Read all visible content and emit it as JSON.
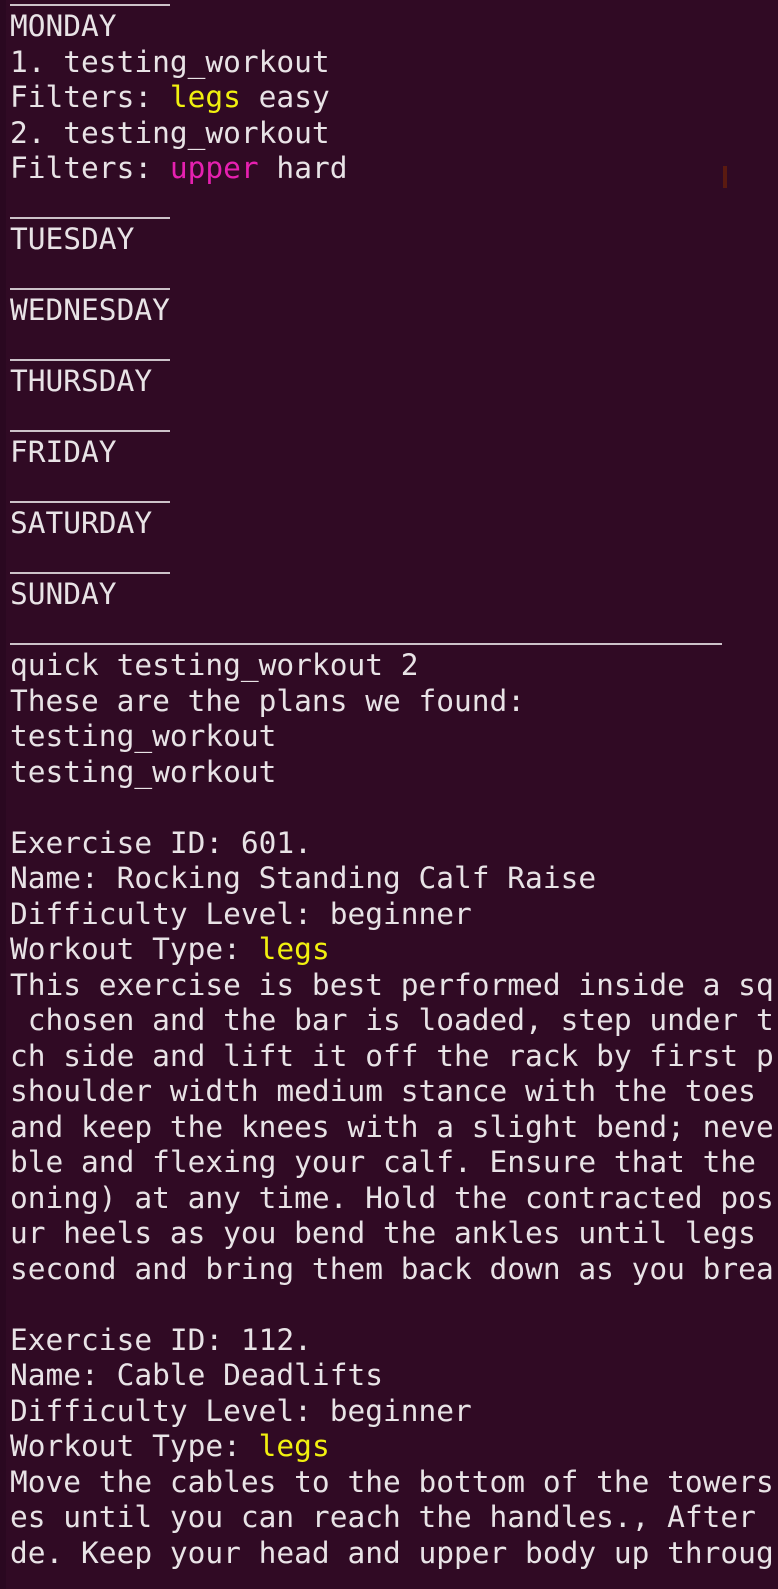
{
  "colors": {
    "background": "#300a24",
    "text": "#e8e3e6",
    "legs_tag": "#f1f10f",
    "upper_tag": "#e620b0"
  },
  "schedule": {
    "monday": "MONDAY",
    "workouts": [
      {
        "line": "1. testing_workout",
        "filters_label": "Filters: ",
        "tag": "legs",
        "level": " easy"
      },
      {
        "line": "2. testing_workout",
        "filters_label": "Filters: ",
        "tag": "upper",
        "level": " hard"
      }
    ],
    "days": [
      "TUESDAY",
      "WEDNESDAY",
      "THURSDAY",
      "FRIDAY",
      "SATURDAY",
      "SUNDAY"
    ]
  },
  "quick": {
    "command": "quick testing_workout 2",
    "found_message": "These are the plans we found:",
    "plans": [
      "testing_workout",
      "testing_workout"
    ]
  },
  "exercises": [
    {
      "id_line": "Exercise ID: 601.",
      "name_line": "Name: Rocking Standing Calf Raise",
      "difficulty_line": "Difficulty Level: beginner",
      "type_label": "Workout Type: ",
      "type_value": "legs",
      "description_lines": [
        "This exercise is best performed inside a sq",
        " chosen and the bar is loaded, step under t",
        "ch side and lift it off the rack by first p",
        "shoulder width medium stance with the toes ",
        "and keep the knees with a slight bend; neve",
        "ble and flexing your calf. Ensure that the ",
        "oning) at any time. Hold the contracted pos",
        "ur heels as you bend the ankles until legs ",
        "second and bring them back down as you brea"
      ]
    },
    {
      "id_line": "Exercise ID: 112.",
      "name_line": "Name: Cable Deadlifts",
      "difficulty_line": "Difficulty Level: beginner",
      "type_label": "Workout Type: ",
      "type_value": "legs",
      "description_lines": [
        "Move the cables to the bottom of the towers",
        "es until you can reach the handles., After ",
        "de. Keep your head and upper body up throug"
      ]
    }
  ]
}
